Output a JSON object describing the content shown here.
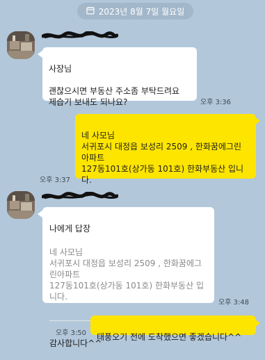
{
  "colors": {
    "background": "#b2c7da",
    "incoming_bubble": "#ffffff",
    "outgoing_bubble": "#fee500",
    "date_pill": "#a3b7ca"
  },
  "date_label": "2023년 8월 7일 월요일",
  "messages": [
    {
      "direction": "incoming",
      "avatar_icon": "profile-photo",
      "text": "사장님\n\n괜찮으시면 부동산 주소좀 부탁드려요\n제습기 보내도 되나요?",
      "time": "오후 3:36"
    },
    {
      "direction": "outgoing",
      "text": "네 사모님\n서귀포시 대정읍 보성리 2509 , 한화꿈에그린\n아파트\n127동101호(상가동 101호) 한화부동산 입니\n다.",
      "time": "오후 3:37"
    },
    {
      "direction": "incoming",
      "avatar_icon": "profile-photo",
      "reply_label": "나에게 답장",
      "quoted_text": "네 사모님\n서귀포시 대정읍 보성리 2509 , 한화꿈에그\n린아파트\n127동101호(상가동 101호) 한화부동산 입\n니다.",
      "text": "감사합니다^^",
      "time": "오후 3:48"
    },
    {
      "direction": "outgoing",
      "text": "태풍오기 전에 도착했으면 좋겠습니다^^",
      "time": "오후 3:50"
    }
  ]
}
